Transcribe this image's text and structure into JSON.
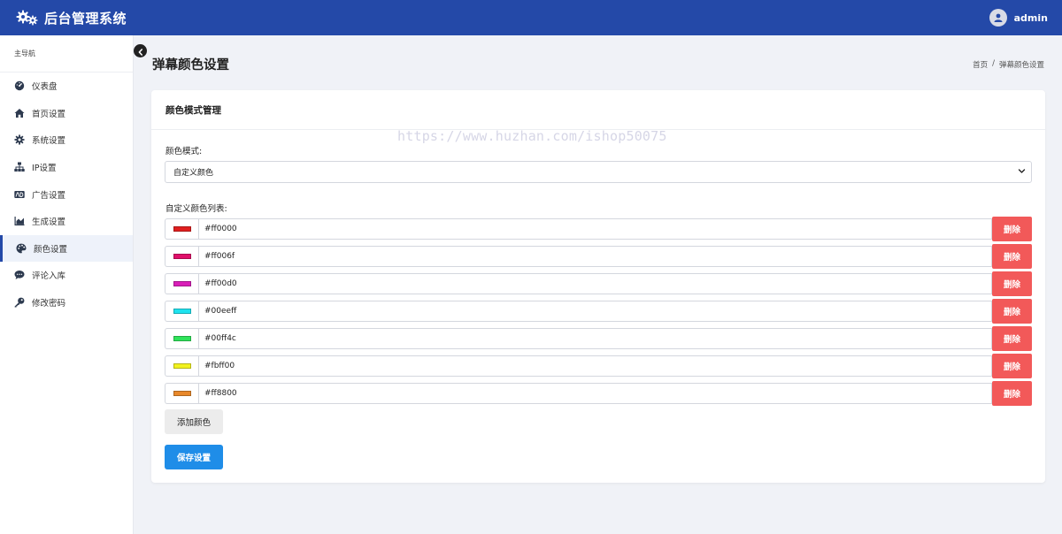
{
  "header": {
    "title": "后台管理系统",
    "user": "admin"
  },
  "sidebar": {
    "heading": "主导航",
    "items": [
      {
        "label": "仪表盘",
        "icon": "dashboard-icon"
      },
      {
        "label": "首页设置",
        "icon": "home-icon"
      },
      {
        "label": "系统设置",
        "icon": "gear-icon"
      },
      {
        "label": "IP设置",
        "icon": "network-icon"
      },
      {
        "label": "广告设置",
        "icon": "ad-icon"
      },
      {
        "label": "生成设置",
        "icon": "chart-icon"
      },
      {
        "label": "颜色设置",
        "icon": "palette-icon",
        "active": true
      },
      {
        "label": "评论入库",
        "icon": "comment-icon"
      },
      {
        "label": "修改密码",
        "icon": "key-icon"
      }
    ]
  },
  "page": {
    "title": "弹幕颜色设置",
    "breadcrumb": {
      "home": "首页",
      "separator": "/",
      "current": "弹幕颜色设置"
    }
  },
  "card": {
    "title": "颜色模式管理",
    "watermark": "https://www.huzhan.com/ishop50075",
    "mode_label": "颜色模式:",
    "mode_value": "自定义颜色",
    "list_label": "自定义颜色列表:",
    "colors": [
      {
        "hex": "#ff0000",
        "swatch": "#e01f1f"
      },
      {
        "hex": "#ff006f",
        "swatch": "#e0106a"
      },
      {
        "hex": "#ff00d0",
        "swatch": "#d91fb8"
      },
      {
        "hex": "#00eeff",
        "swatch": "#1fe3ef"
      },
      {
        "hex": "#00ff4c",
        "swatch": "#2fe35a"
      },
      {
        "hex": "#fbff00",
        "swatch": "#f2f21f"
      },
      {
        "hex": "#ff8800",
        "swatch": "#e8882a"
      }
    ],
    "delete_label": "删除",
    "add_label": "添加颜色",
    "save_label": "保存设置"
  }
}
